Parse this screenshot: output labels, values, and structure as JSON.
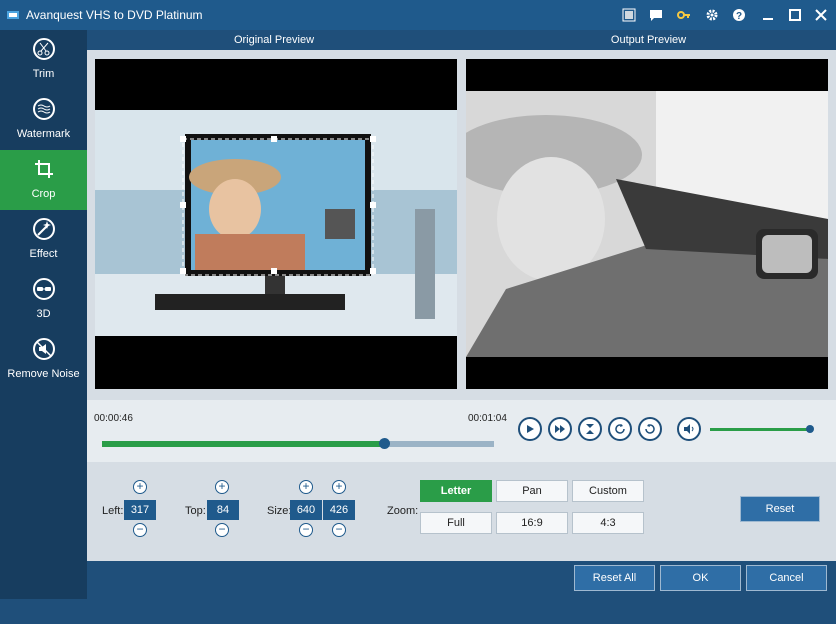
{
  "titlebar": {
    "title": "Avanquest VHS to DVD Platinum",
    "icons": [
      "media-icon",
      "message-icon",
      "key-icon",
      "gear-icon",
      "help-icon",
      "minimize-icon",
      "maximize-icon",
      "close-icon"
    ]
  },
  "sidebar": {
    "items": [
      {
        "label": "Trim",
        "icon": "scissors-icon"
      },
      {
        "label": "Watermark",
        "icon": "watermark-icon"
      },
      {
        "label": "Crop",
        "icon": "crop-icon"
      },
      {
        "label": "Effect",
        "icon": "effect-icon"
      },
      {
        "label": "3D",
        "icon": "3d-glasses-icon"
      },
      {
        "label": "Remove Noise",
        "icon": "remove-noise-icon"
      }
    ],
    "active": "Crop"
  },
  "preview": {
    "original_label": "Original Preview",
    "output_label": "Output Preview"
  },
  "timeline": {
    "current_time": "00:00:46",
    "total_time": "00:01:04",
    "progress": 0.72,
    "volume": 1.0
  },
  "crop": {
    "left_label": "Left:",
    "left_value": "317",
    "top_label": "Top:",
    "top_value": "84",
    "size_label": "Size:",
    "width_value": "640",
    "height_value": "426",
    "zoom_label": "Zoom:",
    "zoom_options": [
      "Letter",
      "Pan",
      "Custom",
      "Full",
      "16:9",
      "4:3"
    ],
    "zoom_selected": "Letter",
    "reset_label": "Reset"
  },
  "footer": {
    "reset_all_label": "Reset All",
    "ok_label": "OK",
    "cancel_label": "Cancel"
  },
  "colors": {
    "accent_green": "#2a9d48",
    "primary_blue": "#1f5a8c",
    "sidebar_bg": "#173d5f"
  }
}
